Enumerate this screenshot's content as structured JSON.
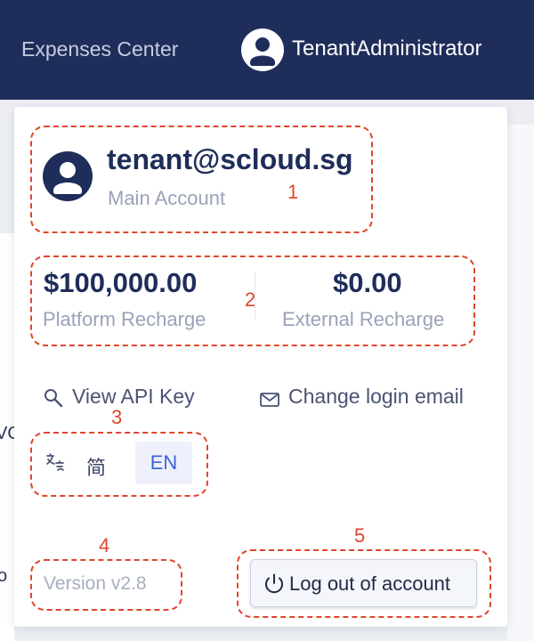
{
  "header": {
    "title": "Expenses Center",
    "user_name": "TenantAdministrator"
  },
  "background": {
    "frag_text_1": "VO",
    "frag_text_2": "o"
  },
  "account": {
    "email": "tenant@scloud.sg",
    "type": "Main Account"
  },
  "balances": {
    "platform": {
      "amount": "$100,000.00",
      "label": "Platform Recharge"
    },
    "external": {
      "amount": "$0.00",
      "label": "External Recharge"
    }
  },
  "actions": {
    "view_api_key": "View API Key",
    "change_email": "Change login email"
  },
  "language": {
    "options": [
      "简",
      "EN"
    ],
    "selected": "EN"
  },
  "version": "Version v2.8",
  "logout_label": "Log out of account",
  "annotations": [
    "1",
    "2",
    "3",
    "4",
    "5"
  ],
  "colors": {
    "header_bg": "#1f2d5a",
    "annotation": "#e0452b",
    "accent": "#3d64d9"
  }
}
